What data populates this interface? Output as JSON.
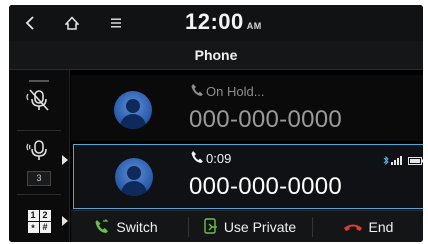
{
  "status_bar": {
    "time": "12:00",
    "ampm": "AM",
    "icons": [
      "back-icon",
      "home-icon",
      "menu-icon"
    ]
  },
  "header": {
    "title": "Phone"
  },
  "sidebar": {
    "items": [
      {
        "name": "mute-mic",
        "icon": "microphone-muted-icon"
      },
      {
        "name": "mic-volume",
        "icon": "microphone-icon",
        "value": "3"
      },
      {
        "name": "keypad",
        "icon": "keypad-icon",
        "keys": [
          "1",
          "2",
          "*",
          "#"
        ]
      }
    ]
  },
  "calls": {
    "on_hold": {
      "status": "On Hold...",
      "number": "000-000-0000"
    },
    "active": {
      "duration": "0:09",
      "number": "000-000-0000",
      "indicators": [
        "bluetooth-icon",
        "signal-icon",
        "battery-icon"
      ]
    }
  },
  "actions": {
    "switch_label": "Switch",
    "use_private_label": "Use Private",
    "end_label": "End"
  },
  "colors": {
    "accent_green": "#6cc04a",
    "end_red": "#e03c2e",
    "active_border": "#4fa8d6",
    "hold_text": "#8d8d8d"
  }
}
